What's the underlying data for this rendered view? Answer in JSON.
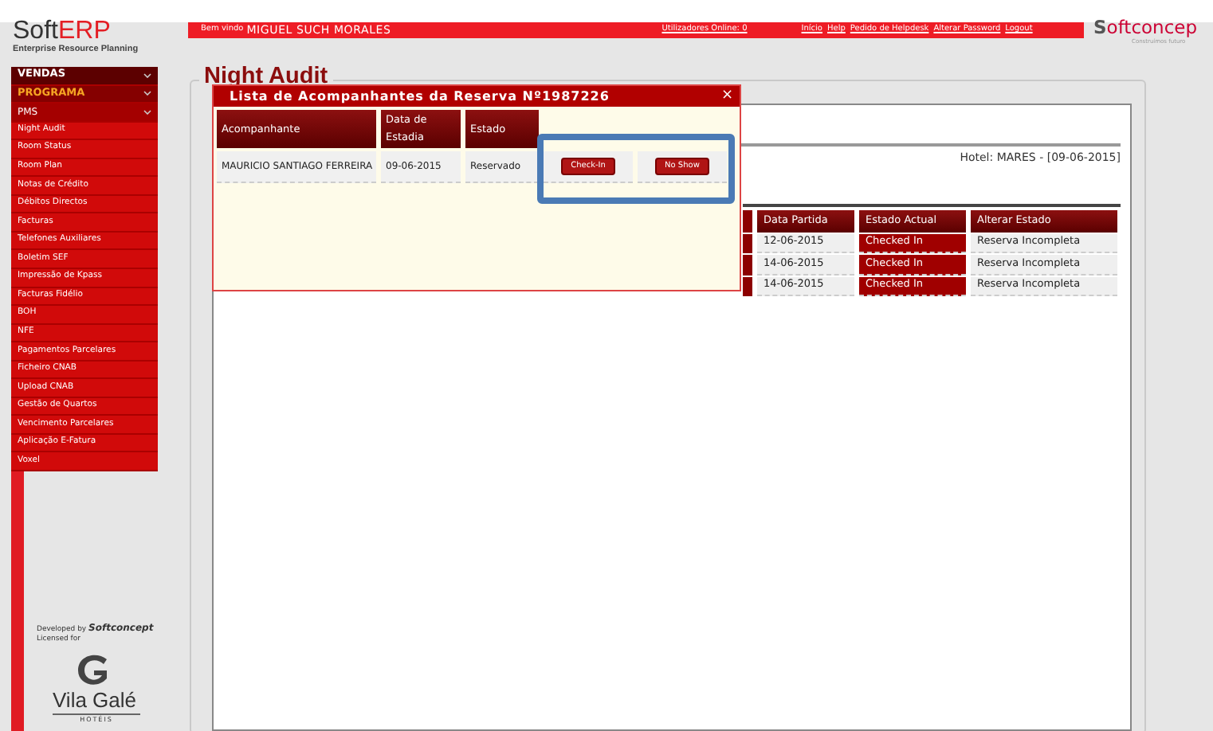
{
  "header": {
    "logo": {
      "brand_a": "Soft",
      "brand_b": "ERP",
      "tagline": "Enterprise Resource Planning"
    },
    "welcome": "Bem vindo",
    "user": "MIGUEL SUCH MORALES",
    "online": "Utilizadores Online: 0",
    "links": [
      "Início",
      "Help",
      "Pedido de Helpdesk",
      "Alterar Password",
      "Logout"
    ],
    "company_logo": {
      "initial": "S",
      "rest": "oftconcep",
      "tagline": "Construímos futuro"
    }
  },
  "sidebar": {
    "items": [
      {
        "label": "VENDAS",
        "kind": "section"
      },
      {
        "label": "PROGRAMA",
        "kind": "group"
      },
      {
        "label": "PMS",
        "kind": "subgroup"
      },
      {
        "label": "Night Audit",
        "kind": "item"
      },
      {
        "label": "Room Status",
        "kind": "item"
      },
      {
        "label": "Room Plan",
        "kind": "item"
      },
      {
        "label": "Notas de Crédito",
        "kind": "item"
      },
      {
        "label": "Débitos Directos",
        "kind": "item"
      },
      {
        "label": "Facturas",
        "kind": "item"
      },
      {
        "label": "Telefones Auxiliares",
        "kind": "item"
      },
      {
        "label": "Boletim SEF",
        "kind": "item"
      },
      {
        "label": "Impressão de Kpass",
        "kind": "item"
      },
      {
        "label": "Facturas Fidélio",
        "kind": "item"
      },
      {
        "label": "BOH",
        "kind": "item"
      },
      {
        "label": "NFE",
        "kind": "item"
      },
      {
        "label": "Pagamentos Parcelares",
        "kind": "item"
      },
      {
        "label": "Ficheiro CNAB",
        "kind": "item"
      },
      {
        "label": "Upload CNAB",
        "kind": "item"
      },
      {
        "label": "Gestão de Quartos",
        "kind": "item"
      },
      {
        "label": "Vencimento Parcelares",
        "kind": "item"
      },
      {
        "label": "Aplicação E-Fatura",
        "kind": "item"
      },
      {
        "label": "Voxel",
        "kind": "item"
      }
    ],
    "footer": {
      "developed_by": "Developed by",
      "developer": "Softconcept",
      "licensed_for": "Licensed for",
      "licensee": "Vila Galé",
      "licensee_sub": "HOTÉIS"
    }
  },
  "page": {
    "title": "Night Audit",
    "hotel": "Hotel: MARES - [09-06-2015]",
    "table": {
      "columns": [
        "Data Partida",
        "Estado Actual",
        "Alterar Estado"
      ],
      "rows": [
        {
          "data_partida": "12-06-2015",
          "estado_actual": "Checked In",
          "alterar_estado": "Reserva Incompleta"
        },
        {
          "data_partida": "14-06-2015",
          "estado_actual": "Checked In",
          "alterar_estado": "Reserva Incompleta"
        },
        {
          "data_partida": "14-06-2015",
          "estado_actual": "Checked In",
          "alterar_estado": "Reserva Incompleta"
        }
      ]
    }
  },
  "dialog": {
    "title": "Lista de Acompanhantes da Reserva Nº1987226",
    "close": "×",
    "columns": [
      "Acompanhante",
      "Data de Estadia",
      "Estado"
    ],
    "rows": [
      {
        "acompanhante": "MAURICIO SANTIAGO FERREIRA",
        "data": "09-06-2015",
        "estado": "Reservado",
        "actions": [
          "Check-In",
          "No Show"
        ]
      }
    ]
  },
  "annotation": {
    "kind": "rectangle",
    "color": "#4a7ab5"
  }
}
